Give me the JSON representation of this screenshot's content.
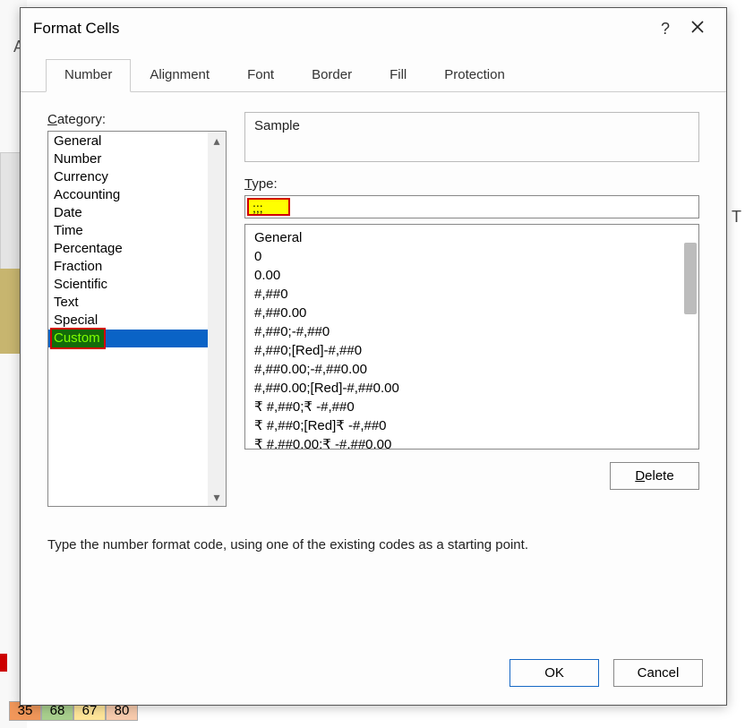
{
  "dialog": {
    "title": "Format Cells",
    "help_char": "?",
    "tabs": [
      "Number",
      "Alignment",
      "Font",
      "Border",
      "Fill",
      "Protection"
    ],
    "active_tab": 0,
    "category_label": "Category:",
    "categories": [
      "General",
      "Number",
      "Currency",
      "Accounting",
      "Date",
      "Time",
      "Percentage",
      "Fraction",
      "Scientific",
      "Text",
      "Special",
      "Custom"
    ],
    "selected_category_index": 11,
    "sample_label": "Sample",
    "sample_value": "",
    "type_label": "Type:",
    "type_value": ";;;",
    "format_codes": [
      "General",
      "0",
      "0.00",
      "#,##0",
      "#,##0.00",
      "#,##0;-#,##0",
      "#,##0;[Red]-#,##0",
      "#,##0.00;-#,##0.00",
      "#,##0.00;[Red]-#,##0.00",
      "₹ #,##0;₹ -#,##0",
      "₹ #,##0;[Red]₹ -#,##0",
      "₹ #,##0.00;₹ -#,##0.00"
    ],
    "delete_label": "Delete",
    "hint": "Type the number format code, using one of the existing codes as a starting point.",
    "ok_label": "OK",
    "cancel_label": "Cancel"
  },
  "background": {
    "col_header_letter": "A",
    "right_letter": "T",
    "bottom_cells": [
      "35",
      "68",
      "67",
      "80"
    ]
  }
}
